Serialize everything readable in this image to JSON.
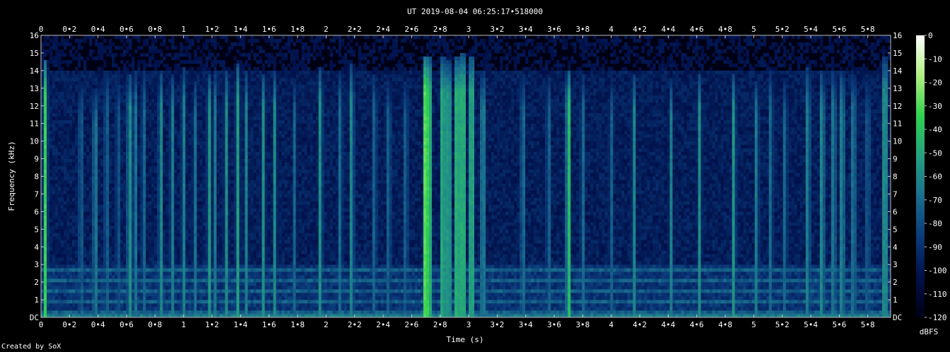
{
  "chart_data": {
    "type": "heatmap",
    "title": "UT 2019-08-04 06:25:17•518000",
    "xlabel": "Time (s)",
    "ylabel": "Frequency (kHz)",
    "xlim": [
      0,
      5.96
    ],
    "ylim": [
      0,
      16
    ],
    "x_ticks": [
      "0",
      "0•2",
      "0•4",
      "0•6",
      "0•8",
      "1",
      "1•2",
      "1•4",
      "1•6",
      "1•8",
      "2",
      "2•2",
      "2•4",
      "2•6",
      "2•8",
      "3",
      "3•2",
      "3•4",
      "3•6",
      "3•8",
      "4",
      "4•2",
      "4•4",
      "4•6",
      "4•8",
      "5",
      "5•2",
      "5•4",
      "5•6",
      "5•8"
    ],
    "x_tick_values": [
      0,
      0.2,
      0.4,
      0.6,
      0.8,
      1.0,
      1.2,
      1.4,
      1.6,
      1.8,
      2.0,
      2.2,
      2.4,
      2.6,
      2.8,
      3.0,
      3.2,
      3.4,
      3.6,
      3.8,
      4.0,
      4.2,
      4.4,
      4.6,
      4.8,
      5.0,
      5.2,
      5.4,
      5.6,
      5.8
    ],
    "y_ticks": [
      "DC",
      "1",
      "2",
      "3",
      "4",
      "5",
      "6",
      "7",
      "8",
      "9",
      "10",
      "11",
      "12",
      "13",
      "14",
      "15",
      "16"
    ],
    "y_tick_values": [
      0,
      1,
      2,
      3,
      4,
      5,
      6,
      7,
      8,
      9,
      10,
      11,
      12,
      13,
      14,
      15,
      16
    ],
    "colorbar": {
      "label": "dBFS",
      "range": [
        -120,
        0
      ],
      "ticks": [
        "0",
        "-10",
        "-20",
        "-30",
        "-40",
        "-50",
        "-60",
        "-70",
        "-80",
        "-90",
        "-100",
        "-110",
        "-120"
      ],
      "tick_values": [
        0,
        -10,
        -20,
        -30,
        -40,
        -50,
        -60,
        -70,
        -80,
        -90,
        -100,
        -110,
        -120
      ]
    },
    "events": [
      {
        "t": 0.03,
        "top": 14.6,
        "level": 0.7
      },
      {
        "t": 0.28,
        "top": 13.5,
        "level": 0.45
      },
      {
        "t": 0.38,
        "top": 13.0,
        "level": 0.55
      },
      {
        "t": 0.46,
        "top": 14.0,
        "level": 0.45
      },
      {
        "t": 0.54,
        "top": 13.8,
        "level": 0.4
      },
      {
        "t": 0.62,
        "top": 13.9,
        "level": 0.6
      },
      {
        "t": 0.66,
        "top": 14.0,
        "level": 0.5
      },
      {
        "t": 0.72,
        "top": 14.1,
        "level": 0.45
      },
      {
        "t": 0.84,
        "top": 14.0,
        "level": 0.55
      },
      {
        "t": 0.92,
        "top": 13.8,
        "level": 0.5
      },
      {
        "t": 1.0,
        "top": 14.2,
        "level": 0.5
      },
      {
        "t": 1.08,
        "top": 13.5,
        "level": 0.45
      },
      {
        "t": 1.18,
        "top": 13.9,
        "level": 0.55
      },
      {
        "t": 1.22,
        "top": 14.0,
        "level": 0.45
      },
      {
        "t": 1.3,
        "top": 14.0,
        "level": 0.5
      },
      {
        "t": 1.38,
        "top": 14.5,
        "level": 0.55
      },
      {
        "t": 1.44,
        "top": 14.0,
        "level": 0.45
      },
      {
        "t": 1.56,
        "top": 13.9,
        "level": 0.5
      },
      {
        "t": 1.64,
        "top": 14.0,
        "level": 0.5
      },
      {
        "t": 1.78,
        "top": 13.5,
        "level": 0.4
      },
      {
        "t": 1.96,
        "top": 14.2,
        "level": 0.55
      },
      {
        "t": 2.1,
        "top": 14.0,
        "level": 0.45
      },
      {
        "t": 2.18,
        "top": 14.4,
        "level": 0.55
      },
      {
        "t": 2.34,
        "top": 13.9,
        "level": 0.45
      },
      {
        "t": 2.44,
        "top": 13.5,
        "level": 0.45
      },
      {
        "t": 2.56,
        "top": 13.5,
        "level": 0.45
      },
      {
        "t": 2.7,
        "top": 14.9,
        "level": 1.0
      },
      {
        "t": 2.72,
        "top": 14.8,
        "level": 0.95
      },
      {
        "t": 2.82,
        "top": 14.8,
        "level": 0.8
      },
      {
        "t": 2.86,
        "top": 14.6,
        "level": 0.75
      },
      {
        "t": 2.92,
        "top": 14.8,
        "level": 0.85
      },
      {
        "t": 2.96,
        "top": 15.0,
        "level": 0.85
      },
      {
        "t": 3.02,
        "top": 14.9,
        "level": 0.8
      },
      {
        "t": 3.1,
        "top": 14.0,
        "level": 0.6
      },
      {
        "t": 3.38,
        "top": 13.8,
        "level": 0.5
      },
      {
        "t": 3.56,
        "top": 13.8,
        "level": 0.45
      },
      {
        "t": 3.7,
        "top": 14.1,
        "level": 0.75
      },
      {
        "t": 3.8,
        "top": 13.8,
        "level": 0.45
      },
      {
        "t": 4.0,
        "top": 13.5,
        "level": 0.4
      },
      {
        "t": 4.16,
        "top": 13.8,
        "level": 0.5
      },
      {
        "t": 4.42,
        "top": 13.5,
        "level": 0.45
      },
      {
        "t": 4.62,
        "top": 13.9,
        "level": 0.5
      },
      {
        "t": 4.86,
        "top": 13.9,
        "level": 0.55
      },
      {
        "t": 5.02,
        "top": 13.5,
        "level": 0.5
      },
      {
        "t": 5.12,
        "top": 14.0,
        "level": 0.45
      },
      {
        "t": 5.22,
        "top": 13.5,
        "level": 0.45
      },
      {
        "t": 5.38,
        "top": 14.2,
        "level": 0.55
      },
      {
        "t": 5.48,
        "top": 14.0,
        "level": 0.6
      },
      {
        "t": 5.56,
        "top": 14.1,
        "level": 0.55
      },
      {
        "t": 5.62,
        "top": 14.0,
        "level": 0.6
      },
      {
        "t": 5.7,
        "top": 13.8,
        "level": 0.55
      },
      {
        "t": 5.8,
        "top": 13.5,
        "level": 0.45
      },
      {
        "t": 5.92,
        "top": 14.8,
        "level": 0.7
      }
    ],
    "hum_bands_khz": [
      0.3,
      0.9,
      1.5,
      2.1,
      2.7
    ],
    "colormap": [
      "#000014",
      "#00104a",
      "#0a3a7a",
      "#1a6e8e",
      "#24a080",
      "#30d050",
      "#b0f080",
      "#ffffff"
    ]
  },
  "footer": {
    "credit": "Created by SoX"
  }
}
